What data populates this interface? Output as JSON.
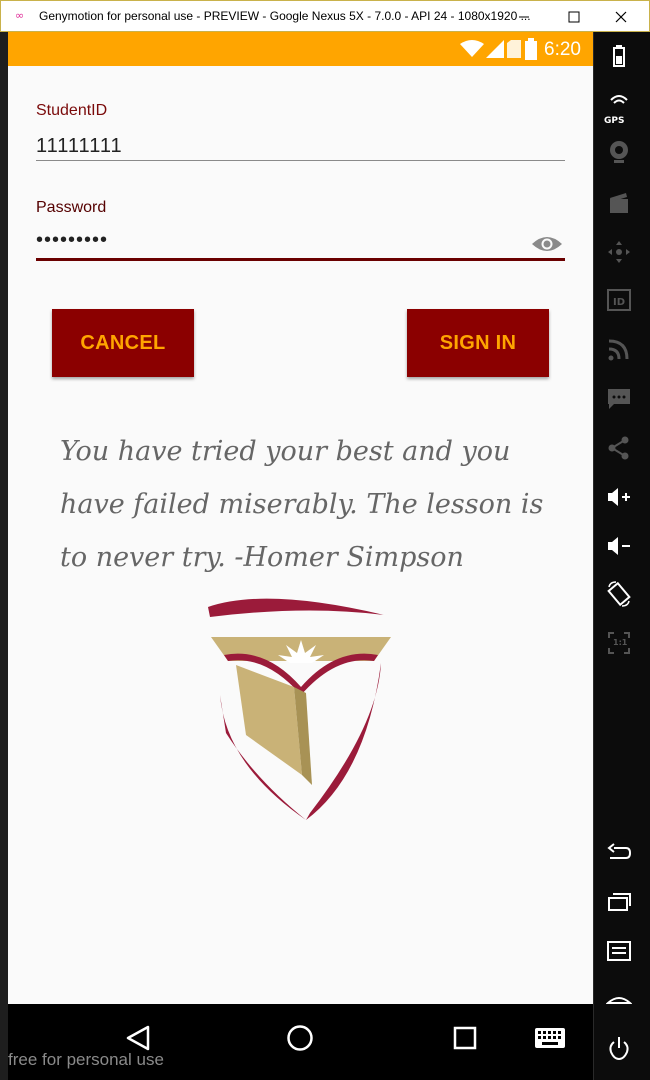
{
  "window": {
    "title": "Genymotion for personal use - PREVIEW - Google Nexus 5X - 7.0.0 - API 24 - 1080x1920 ...",
    "logo": "∞"
  },
  "statusbar": {
    "time": "6:20"
  },
  "form": {
    "student_label": "StudentID",
    "student_value": "11111111",
    "password_label": "Password",
    "password_value": "•••••••••"
  },
  "buttons": {
    "cancel": "CANCEL",
    "sign_in": "SIGN IN"
  },
  "quote": "You have tried your best and you have failed miserably. The lesson is to never try. -Homer Simpson",
  "right_panel": {
    "gps": "GPS",
    "ratio": "1:1"
  },
  "footer": {
    "watermark": "free for personal use"
  },
  "colors": {
    "accent": "#ffa500",
    "primary": "#8b0000",
    "label": "#7a0a0a",
    "shield_crimson": "#9b1b3a",
    "shield_gold": "#c9b277"
  },
  "icons": [
    "wifi-icon",
    "signal-icon",
    "sim-icon",
    "battery-icon",
    "eye-icon",
    "back-icon",
    "home-icon",
    "recents-icon",
    "keyboard-icon"
  ]
}
